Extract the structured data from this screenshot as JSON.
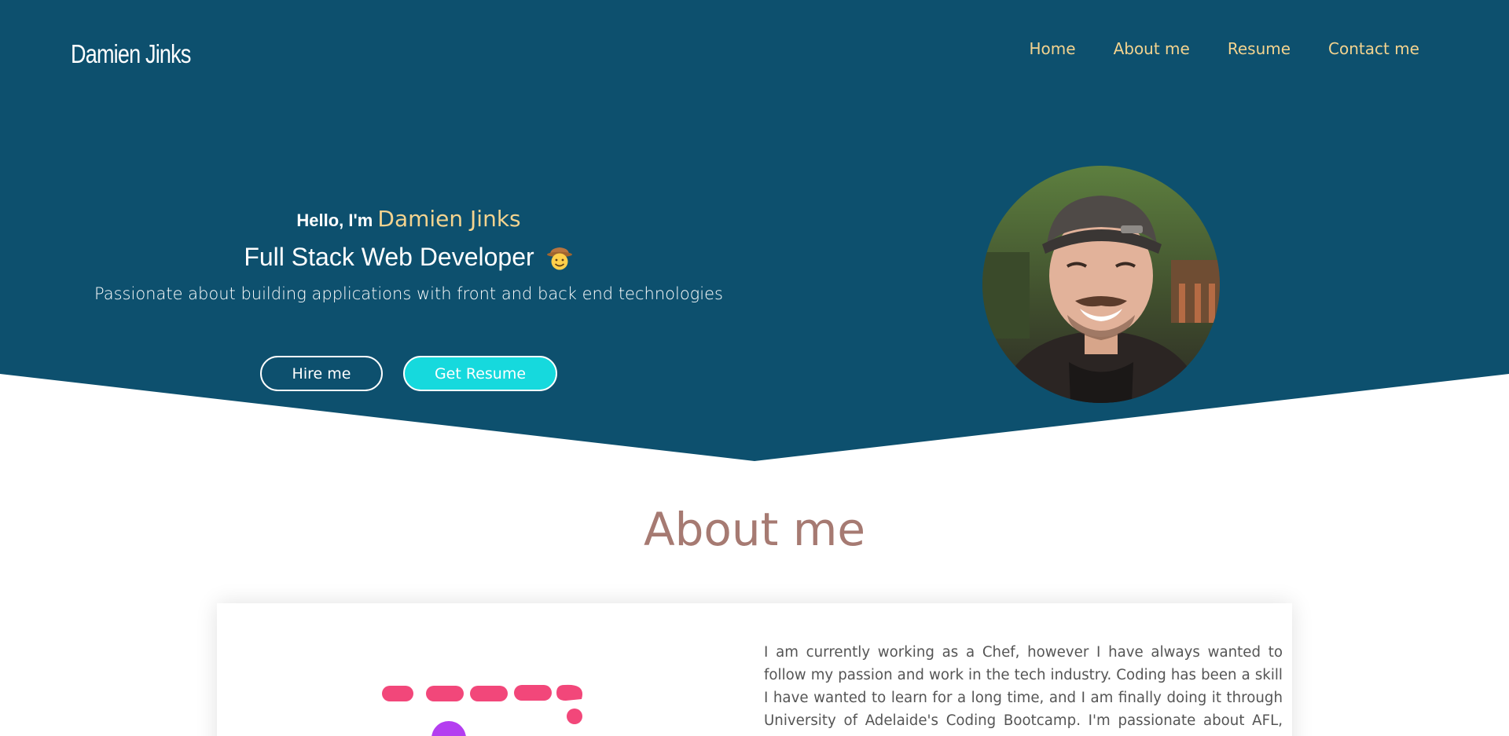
{
  "header": {
    "brand": "Damien Jinks",
    "nav": [
      {
        "label": "Home"
      },
      {
        "label": "About me"
      },
      {
        "label": "Resume"
      },
      {
        "label": "Contact me"
      }
    ]
  },
  "hero": {
    "hello_prefix": "Hello, I'm",
    "name": "Damien Jinks",
    "role": "Full Stack Web Developer",
    "tagline": "Passionate about building applications with front and back end technologies",
    "hire_label": "Hire me",
    "resume_label": "Get Resume",
    "avatar_icon": "profile-photo"
  },
  "about": {
    "title": "About me",
    "paragraph": "I am currently working as a Chef, however I have always wanted to follow my passion and work in the tech industry. Coding has been a skill I have wanted to learn for a long time, and I am finally doing it through University of Adelaide's Coding Bootcamp. I'm passionate about AFL, Web development"
  },
  "colors": {
    "hero_bg": "#0d506e",
    "accent_gold": "#f3d38f",
    "button_cyan": "#16d9dd",
    "about_title": "#a67a72"
  }
}
